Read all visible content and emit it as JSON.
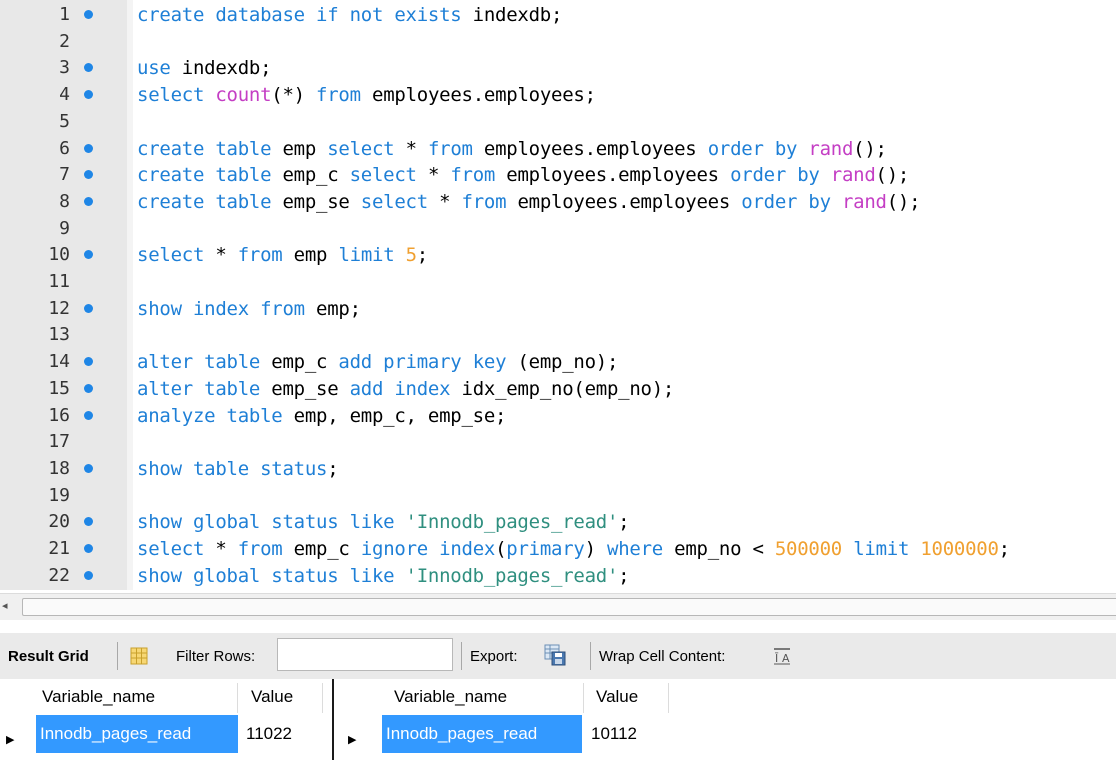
{
  "editor": {
    "lines": [
      {
        "n": "1",
        "dot": true,
        "tokens": [
          [
            "kw",
            "create database if not exists "
          ],
          [
            "plain",
            "indexdb;"
          ]
        ]
      },
      {
        "n": "2",
        "dot": false,
        "tokens": []
      },
      {
        "n": "3",
        "dot": true,
        "tokens": [
          [
            "kw",
            "use "
          ],
          [
            "plain",
            "indexdb;"
          ]
        ]
      },
      {
        "n": "4",
        "dot": true,
        "tokens": [
          [
            "kw",
            "select "
          ],
          [
            "fn",
            "count"
          ],
          [
            "plain",
            "(*) "
          ],
          [
            "kw",
            "from "
          ],
          [
            "plain",
            "employees.employees;"
          ]
        ]
      },
      {
        "n": "5",
        "dot": false,
        "tokens": []
      },
      {
        "n": "6",
        "dot": true,
        "tokens": [
          [
            "kw",
            "create table "
          ],
          [
            "plain",
            "emp "
          ],
          [
            "kw",
            "select "
          ],
          [
            "plain",
            "* "
          ],
          [
            "kw",
            "from "
          ],
          [
            "plain",
            "employees.employees "
          ],
          [
            "kw",
            "order by "
          ],
          [
            "fn",
            "rand"
          ],
          [
            "plain",
            "();"
          ]
        ]
      },
      {
        "n": "7",
        "dot": true,
        "tokens": [
          [
            "kw",
            "create table "
          ],
          [
            "plain",
            "emp_c "
          ],
          [
            "kw",
            "select "
          ],
          [
            "plain",
            "* "
          ],
          [
            "kw",
            "from "
          ],
          [
            "plain",
            "employees.employees "
          ],
          [
            "kw",
            "order by "
          ],
          [
            "fn",
            "rand"
          ],
          [
            "plain",
            "();"
          ]
        ]
      },
      {
        "n": "8",
        "dot": true,
        "tokens": [
          [
            "kw",
            "create table "
          ],
          [
            "plain",
            "emp_se "
          ],
          [
            "kw",
            "select "
          ],
          [
            "plain",
            "* "
          ],
          [
            "kw",
            "from "
          ],
          [
            "plain",
            "employees.employees "
          ],
          [
            "kw",
            "order by "
          ],
          [
            "fn",
            "rand"
          ],
          [
            "plain",
            "();"
          ]
        ]
      },
      {
        "n": "9",
        "dot": false,
        "tokens": []
      },
      {
        "n": "10",
        "dot": true,
        "tokens": [
          [
            "kw",
            "select "
          ],
          [
            "plain",
            "* "
          ],
          [
            "kw",
            "from "
          ],
          [
            "plain",
            "emp "
          ],
          [
            "kw",
            "limit "
          ],
          [
            "num",
            "5"
          ],
          [
            "plain",
            ";"
          ]
        ]
      },
      {
        "n": "11",
        "dot": false,
        "tokens": []
      },
      {
        "n": "12",
        "dot": true,
        "tokens": [
          [
            "kw",
            "show index from "
          ],
          [
            "plain",
            "emp;"
          ]
        ]
      },
      {
        "n": "13",
        "dot": false,
        "tokens": []
      },
      {
        "n": "14",
        "dot": true,
        "tokens": [
          [
            "kw",
            "alter table "
          ],
          [
            "plain",
            "emp_c "
          ],
          [
            "kw",
            "add primary key "
          ],
          [
            "plain",
            "(emp_no);"
          ]
        ]
      },
      {
        "n": "15",
        "dot": true,
        "tokens": [
          [
            "kw",
            "alter table "
          ],
          [
            "plain",
            "emp_se "
          ],
          [
            "kw",
            "add index "
          ],
          [
            "plain",
            "idx_emp_no(emp_no);"
          ]
        ]
      },
      {
        "n": "16",
        "dot": true,
        "tokens": [
          [
            "kw",
            "analyze table "
          ],
          [
            "plain",
            "emp, emp_c, emp_se;"
          ]
        ]
      },
      {
        "n": "17",
        "dot": false,
        "tokens": []
      },
      {
        "n": "18",
        "dot": true,
        "tokens": [
          [
            "kw",
            "show table status"
          ],
          [
            "plain",
            ";"
          ]
        ]
      },
      {
        "n": "19",
        "dot": false,
        "tokens": []
      },
      {
        "n": "20",
        "dot": true,
        "tokens": [
          [
            "kw",
            "show global status like "
          ],
          [
            "str",
            "'Innodb_pages_read'"
          ],
          [
            "plain",
            ";"
          ]
        ]
      },
      {
        "n": "21",
        "dot": true,
        "tokens": [
          [
            "kw",
            "select "
          ],
          [
            "plain",
            "* "
          ],
          [
            "kw",
            "from "
          ],
          [
            "plain",
            "emp_c "
          ],
          [
            "kw",
            "ignore index"
          ],
          [
            "plain",
            "("
          ],
          [
            "kw",
            "primary"
          ],
          [
            "plain",
            ") "
          ],
          [
            "kw",
            "where "
          ],
          [
            "plain",
            "emp_no < "
          ],
          [
            "num",
            "500000"
          ],
          [
            "kw",
            " limit "
          ],
          [
            "num",
            "1000000"
          ],
          [
            "plain",
            ";"
          ]
        ]
      },
      {
        "n": "22",
        "dot": true,
        "tokens": [
          [
            "kw",
            "show global status like "
          ],
          [
            "str",
            "'Innodb_pages_read'"
          ],
          [
            "plain",
            ";"
          ]
        ]
      }
    ]
  },
  "scrollbar": {
    "left_arrow": "◂"
  },
  "toolbar": {
    "result_grid": "Result Grid",
    "filter_rows": "Filter Rows:",
    "filter_value": "",
    "export": "Export:",
    "wrap": "Wrap Cell Content:"
  },
  "grids": [
    {
      "headers": [
        "Variable_name",
        "Value"
      ],
      "row": [
        "Innodb_pages_read",
        "11022"
      ]
    },
    {
      "headers": [
        "Variable_name",
        "Value"
      ],
      "row": [
        "Innodb_pages_read",
        "10112"
      ]
    }
  ],
  "row_marker": "▶",
  "colors": {
    "keyword": "#1e7fd6",
    "function": "#c43ec4",
    "number": "#f0a030",
    "string": "#2f8f7f",
    "selection": "#3399ff",
    "marker": "#1f86e6"
  }
}
